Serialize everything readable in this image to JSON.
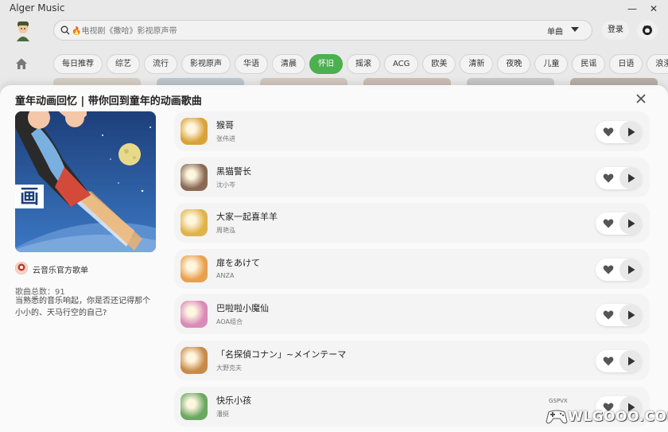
{
  "app": {
    "title": "Alger Music"
  },
  "window": {
    "minimize": "—",
    "close": "✕"
  },
  "header": {
    "search_placeholder": "🔥电视剧《撒哈》影视原声带",
    "search_type": "单曲",
    "login_label": "登录"
  },
  "categories": [
    {
      "label": "每日推荐",
      "active": false
    },
    {
      "label": "综艺",
      "active": false
    },
    {
      "label": "流行",
      "active": false
    },
    {
      "label": "影视原声",
      "active": false
    },
    {
      "label": "华语",
      "active": false
    },
    {
      "label": "清晨",
      "active": false
    },
    {
      "label": "怀旧",
      "active": true
    },
    {
      "label": "摇滚",
      "active": false
    },
    {
      "label": "ACG",
      "active": false
    },
    {
      "label": "欧美",
      "active": false
    },
    {
      "label": "清新",
      "active": false
    },
    {
      "label": "夜晚",
      "active": false
    },
    {
      "label": "儿童",
      "active": false
    },
    {
      "label": "民谣",
      "active": false
    },
    {
      "label": "日语",
      "active": false
    },
    {
      "label": "浪漫",
      "active": false
    }
  ],
  "playlist": {
    "title": "童年动画回忆 | 带你回到童年的动画歌曲",
    "cover_text": "画",
    "creator": "云音乐官方歌单",
    "song_count_label": "歌曲总数：",
    "song_count": "91",
    "description": "当熟悉的音乐响起，你是否还记得那个小小的、天马行空的自己?"
  },
  "songs": [
    {
      "name": "猴哥",
      "artist": "张伟进",
      "art_color": "#d9a23a"
    },
    {
      "name": "黑猫警长",
      "artist": "沈小岑",
      "art_color": "#8a6a55"
    },
    {
      "name": "大家一起喜羊羊",
      "artist": "周艳泓",
      "art_color": "#e0b34a"
    },
    {
      "name": "扉をあけて",
      "artist": "ANZA",
      "art_color": "#e8a050"
    },
    {
      "name": "巴啦啦小魔仙",
      "artist": "AOA组合",
      "art_color": "#d98ab8"
    },
    {
      "name": "「名探偵コナン」~メインテーマ",
      "artist": "大野克夫",
      "art_color": "#c88a4a"
    },
    {
      "name": "快乐小孩",
      "artist": "潘挺",
      "art_color": "#6aa860"
    }
  ],
  "watermark": {
    "main": "WLGOOO.COM",
    "small": "GSPVX"
  }
}
